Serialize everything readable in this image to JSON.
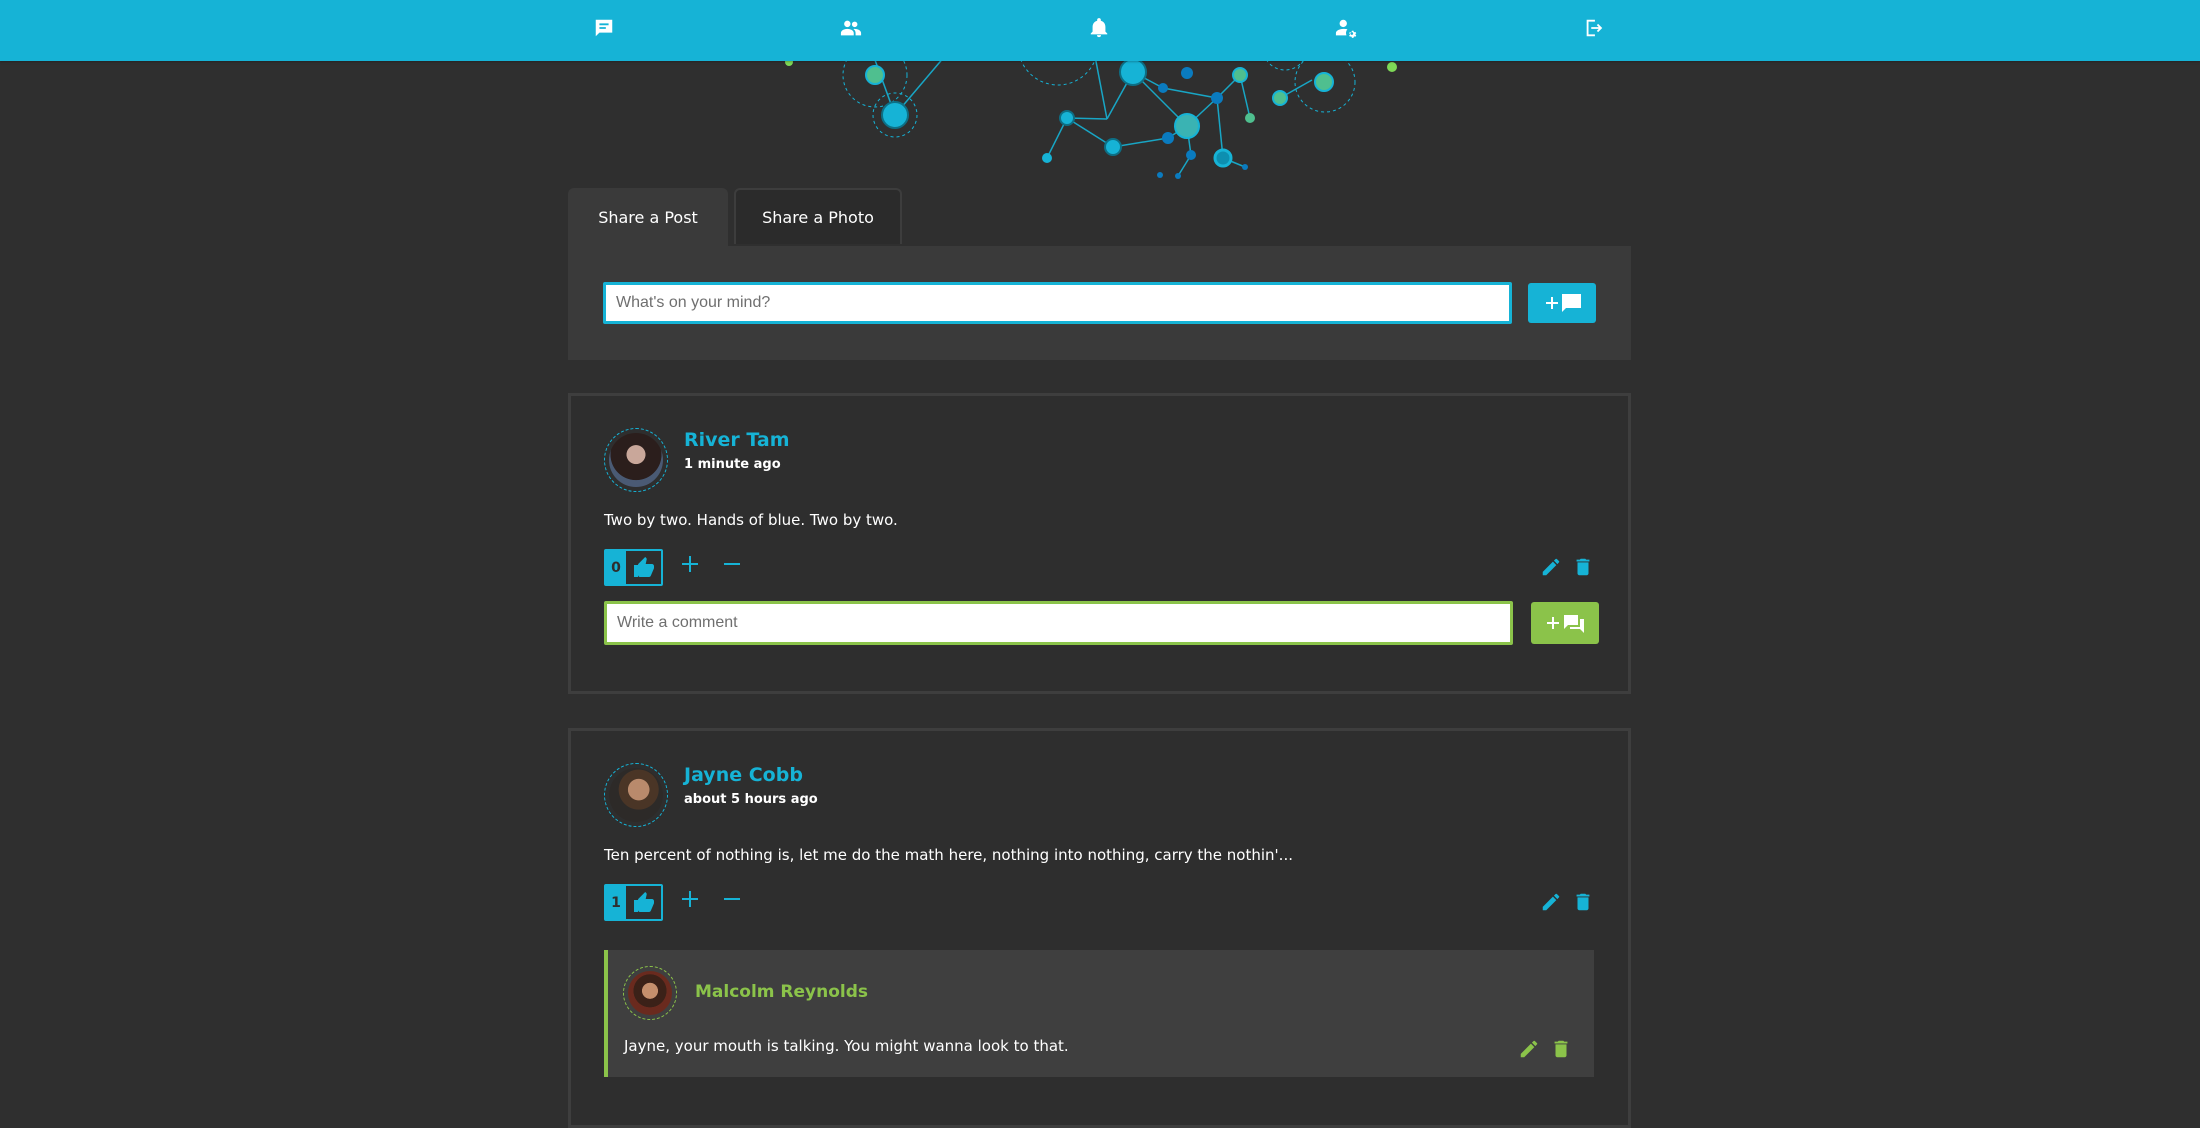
{
  "colors": {
    "accent": "#16b3d6",
    "comment_accent": "#8bc34a",
    "background": "#2f2f2f"
  },
  "nav": {
    "items": [
      {
        "name": "posts",
        "icon": "chat-bubble-icon"
      },
      {
        "name": "friends",
        "icon": "people-icon"
      },
      {
        "name": "notifications",
        "icon": "bell-icon"
      },
      {
        "name": "account-settings",
        "icon": "user-cog-icon"
      },
      {
        "name": "logout",
        "icon": "logout-icon"
      }
    ]
  },
  "share": {
    "tabs": [
      {
        "label": "Share a Post",
        "active": true
      },
      {
        "label": "Share a Photo",
        "active": false
      }
    ],
    "placeholder": "What's on your mind?",
    "submit_icon": "add-post-icon"
  },
  "posts": [
    {
      "author": "River Tam",
      "time": "1 minute ago",
      "text": "Two by two. Hands of blue. Two by two.",
      "likes": "0",
      "comment_placeholder": "Write a comment",
      "comments": []
    },
    {
      "author": "Jayne Cobb",
      "time": "about 5 hours ago",
      "text": "Ten percent of nothing is, let me do the math here, nothing into nothing, carry the nothin'...",
      "likes": "1",
      "comments": [
        {
          "author": "Malcolm Reynolds",
          "text": "Jayne, your mouth is talking. You might wanna look to that."
        }
      ]
    }
  ]
}
